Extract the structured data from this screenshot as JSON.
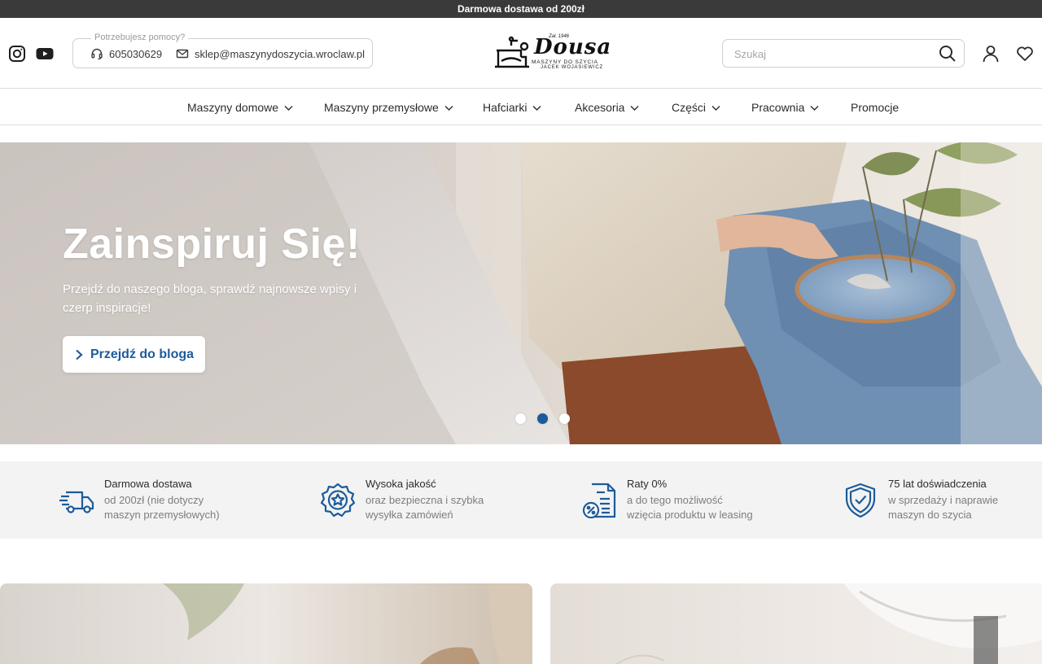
{
  "topbar": {
    "text": "Darmowa dostawa od 200zł"
  },
  "header": {
    "social": [
      {
        "name": "instagram-icon"
      },
      {
        "name": "youtube-icon"
      }
    ],
    "help": {
      "legend": "Potrzebujesz pomocy?",
      "phone": "605030629",
      "email": "sklep@maszynydoszycia.wroclaw.pl"
    },
    "logo": {
      "title": "Dousa",
      "est": "Zał. 1946",
      "line1": "MASZYNY DO SZYCIA",
      "line2": "JACEK WOJASIEWICZ"
    },
    "search": {
      "placeholder": "Szukaj",
      "value": ""
    }
  },
  "nav": {
    "items": [
      {
        "label": "Maszyny domowe",
        "dropdown": true
      },
      {
        "label": "Maszyny przemysłowe",
        "dropdown": true
      },
      {
        "label": "Hafciarki",
        "dropdown": true
      },
      {
        "label": "Akcesoria",
        "dropdown": true
      },
      {
        "label": "Części",
        "dropdown": true
      },
      {
        "label": "Pracownia",
        "dropdown": true
      },
      {
        "label": "Promocje",
        "dropdown": false
      }
    ]
  },
  "hero": {
    "title": "Zainspiruj Się!",
    "subtitle": "Przejdź do naszego bloga, sprawdź najnowsze wpisy i czerp inspiracje!",
    "button_label": "Przejdź do bloga",
    "slides": 3,
    "active_slide": 2
  },
  "features": [
    {
      "icon": "delivery-truck-icon",
      "title": "Darmowa dostawa",
      "line1": "od 200zł (nie dotyczy",
      "line2": "maszyn przemysłowych)"
    },
    {
      "icon": "quality-badge-icon",
      "title": "Wysoka jakość",
      "line1": "oraz bezpieczna i szybka",
      "line2": "wysyłka zamówień"
    },
    {
      "icon": "installment-document-icon",
      "title": "Raty 0%",
      "line1": "a do tego możliwość",
      "line2": "wzięcia produktu w leasing"
    },
    {
      "icon": "shield-check-icon",
      "title": "75 lat doświadczenia",
      "line1": "w sprzedaży i naprawie",
      "line2": "maszyn do szycia"
    }
  ],
  "colors": {
    "accent": "#1d5b9b",
    "topbar": "#3a3a3a",
    "features_bg": "#f3f3f3"
  }
}
